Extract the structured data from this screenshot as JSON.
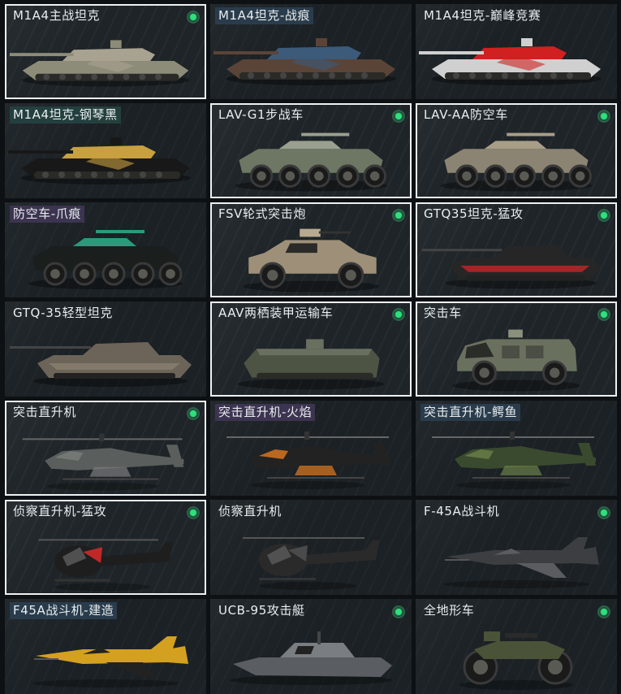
{
  "vehicles": [
    {
      "name": "M1A4主战坦克",
      "selected": true,
      "owned": true,
      "tag": "plain",
      "type": "tank",
      "color": "#8c8c78",
      "accent": "#a8a290"
    },
    {
      "name": "M1A4坦克-战痕",
      "selected": false,
      "owned": false,
      "tag": "blue",
      "type": "tank",
      "color": "#5a4438",
      "accent": "#3c5a7a"
    },
    {
      "name": "M1A4坦克-巅峰竞赛",
      "selected": false,
      "owned": false,
      "tag": "plain",
      "type": "tank",
      "color": "#d0d0d0",
      "accent": "#d02020"
    },
    {
      "name": "M1A4坦克-钢琴黑",
      "selected": false,
      "owned": false,
      "tag": "teal",
      "type": "tank",
      "color": "#181818",
      "accent": "#c8a040"
    },
    {
      "name": "LAV-G1步战车",
      "selected": true,
      "owned": true,
      "tag": "plain",
      "type": "apc",
      "color": "#6e7664",
      "accent": "#9aa08e"
    },
    {
      "name": "LAV-AA防空车",
      "selected": true,
      "owned": true,
      "tag": "plain",
      "type": "apc",
      "color": "#8c8472",
      "accent": "#a89e88"
    },
    {
      "name": "防空车-爪痕",
      "selected": false,
      "owned": false,
      "tag": "purple",
      "type": "apc",
      "color": "#1a1e1c",
      "accent": "#2a9a7a"
    },
    {
      "name": "FSV轮式突击炮",
      "selected": true,
      "owned": true,
      "tag": "plain",
      "type": "humvee",
      "color": "#9e9078",
      "accent": "#b8aa90"
    },
    {
      "name": "GTQ35坦克-猛攻",
      "selected": true,
      "owned": true,
      "tag": "plain",
      "type": "lighttank",
      "color": "#262626",
      "accent": "#c02828"
    },
    {
      "name": "GTQ-35轻型坦克",
      "selected": false,
      "owned": false,
      "tag": "plain",
      "type": "lighttank",
      "color": "#6c6458",
      "accent": "#8a8070"
    },
    {
      "name": "AAV两栖装甲运输车",
      "selected": true,
      "owned": true,
      "tag": "plain",
      "type": "amphib",
      "color": "#4e5444",
      "accent": "#6a7060"
    },
    {
      "name": "突击车",
      "selected": true,
      "owned": true,
      "tag": "plain",
      "type": "mrap",
      "color": "#6a705e",
      "accent": "#8a907c"
    },
    {
      "name": "突击直升机",
      "selected": true,
      "owned": true,
      "tag": "plain",
      "type": "heli",
      "color": "#5a5e5c",
      "accent": "#7a7e7c"
    },
    {
      "name": "突击直升机-火焰",
      "selected": false,
      "owned": false,
      "tag": "purple",
      "type": "heli",
      "color": "#222222",
      "accent": "#e07a20"
    },
    {
      "name": "突击直升机-鳄鱼",
      "selected": false,
      "owned": false,
      "tag": "blue",
      "type": "heli",
      "color": "#3a4a2e",
      "accent": "#6a8048"
    },
    {
      "name": "侦察直升机-猛攻",
      "selected": true,
      "owned": true,
      "tag": "plain",
      "type": "scoutheli",
      "color": "#1e1e1e",
      "accent": "#c02828"
    },
    {
      "name": "侦察直升机",
      "selected": false,
      "owned": false,
      "tag": "plain",
      "type": "scoutheli",
      "color": "#2a2a2a",
      "accent": "#4a4a4a"
    },
    {
      "name": "F-45A战斗机",
      "selected": false,
      "owned": true,
      "tag": "plain",
      "type": "jet",
      "color": "#3c3e42",
      "accent": "#5a5c60"
    },
    {
      "name": "F45A战斗机-建造",
      "selected": false,
      "owned": false,
      "tag": "blue",
      "type": "jet",
      "color": "#d4a020",
      "accent": "#222222"
    },
    {
      "name": "UCB-95攻击艇",
      "selected": false,
      "owned": true,
      "tag": "plain",
      "type": "boat",
      "color": "#5a5e62",
      "accent": "#7a7e82"
    },
    {
      "name": "全地形车",
      "selected": false,
      "owned": true,
      "tag": "plain",
      "type": "atv",
      "color": "#4a5238",
      "accent": "#2a2a2a"
    }
  ]
}
